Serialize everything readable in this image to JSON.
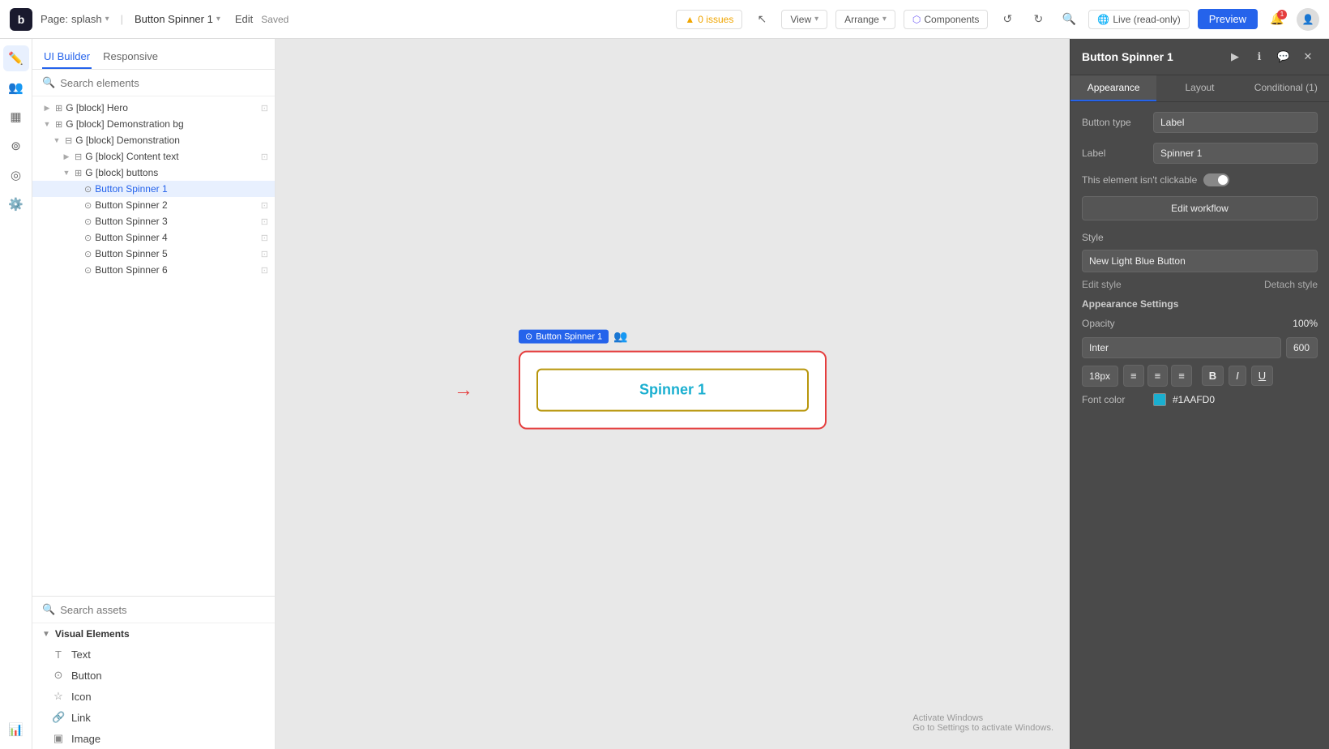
{
  "topbar": {
    "logo": "b",
    "page_label": "Page:",
    "page_name": "splash",
    "component_name": "Button Spinner 1",
    "edit_label": "Edit",
    "saved_label": "Saved",
    "issues_label": "0 issues",
    "view_label": "View",
    "arrange_label": "Arrange",
    "components_label": "Components",
    "live_label": "Live (read-only)",
    "preview_label": "Preview"
  },
  "left_panel": {
    "tab_ui": "UI Builder",
    "tab_responsive": "Responsive",
    "search_placeholder": "Search elements"
  },
  "tree": {
    "items": [
      {
        "id": "hero",
        "label": "G [block] Hero",
        "indent": 1,
        "has_children": true,
        "collapsed": true,
        "action": true
      },
      {
        "id": "demo-bg",
        "label": "G [block] Demonstration bg",
        "indent": 1,
        "has_children": true,
        "collapsed": false
      },
      {
        "id": "demo",
        "label": "G [block] Demonstration",
        "indent": 2,
        "has_children": true,
        "collapsed": false
      },
      {
        "id": "content-text",
        "label": "G [block] Content text",
        "indent": 3,
        "has_children": true,
        "collapsed": true,
        "action": true
      },
      {
        "id": "buttons",
        "label": "G [block] buttons",
        "indent": 3,
        "has_children": true,
        "collapsed": false
      },
      {
        "id": "spinner1",
        "label": "Button Spinner 1",
        "indent": 4,
        "selected": true
      },
      {
        "id": "spinner2",
        "label": "Button Spinner 2",
        "indent": 4,
        "action": true
      },
      {
        "id": "spinner3",
        "label": "Button Spinner 3",
        "indent": 4,
        "action": true
      },
      {
        "id": "spinner4",
        "label": "Button Spinner 4",
        "indent": 4,
        "action": true
      },
      {
        "id": "spinner5",
        "label": "Button Spinner 5",
        "indent": 4,
        "action": true
      },
      {
        "id": "spinner6",
        "label": "Button Spinner 6",
        "indent": 4,
        "action": true
      }
    ]
  },
  "assets": {
    "search_placeholder": "Search assets",
    "visual_elements_label": "Visual Elements",
    "items": [
      {
        "id": "text",
        "label": "Text",
        "icon": "T"
      },
      {
        "id": "button",
        "label": "Button",
        "icon": "⊙"
      },
      {
        "id": "icon",
        "label": "Icon",
        "icon": "☆"
      },
      {
        "id": "link",
        "label": "Link",
        "icon": "🔗"
      },
      {
        "id": "image",
        "label": "Image",
        "icon": "▣"
      }
    ]
  },
  "canvas": {
    "element_badge": "Button Spinner 1",
    "element_text": "Spinner 1"
  },
  "right_panel": {
    "title": "Button Spinner 1",
    "tabs": [
      "Appearance",
      "Layout",
      "Conditional (1)"
    ],
    "active_tab": "Appearance",
    "button_type_label": "Button type",
    "button_type_value": "Label",
    "label_label": "Label",
    "label_value": "Spinner 1",
    "not_clickable_label": "This element isn't clickable",
    "edit_workflow_label": "Edit workflow",
    "style_label": "Style",
    "style_value": "New Light Blue Button",
    "edit_style_label": "Edit style",
    "detach_style_label": "Detach style",
    "appearance_settings_label": "Appearance Settings",
    "opacity_label": "Opacity",
    "opacity_value": "100",
    "opacity_unit": "%",
    "font_name": "Inter",
    "font_weight": "600",
    "font_size": "18px",
    "align_left": "≡",
    "align_center": "≡",
    "align_right": "≡",
    "bold_label": "B",
    "italic_label": "I",
    "underline_label": "U",
    "font_color_label": "Font color",
    "font_color_value": "#1AAFD0",
    "font_color_hex": "#1aafd0"
  },
  "activate_windows": {
    "line1": "Activate Windows",
    "line2": "Go to Settings to activate Windows."
  }
}
